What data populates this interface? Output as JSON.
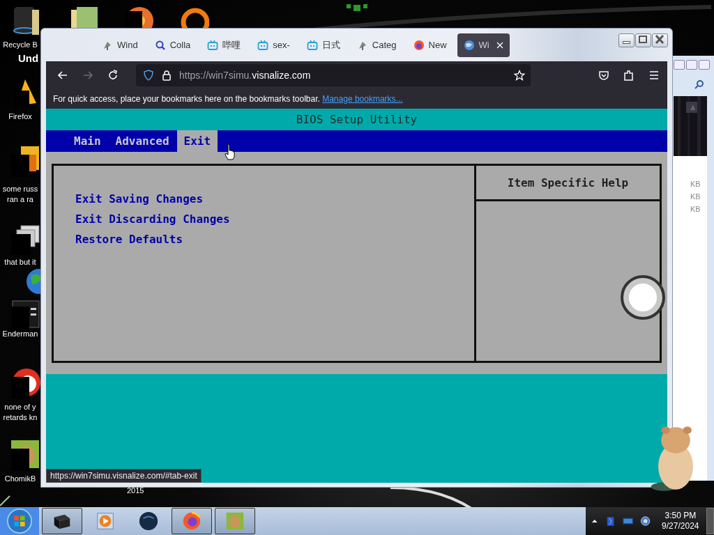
{
  "desktop_icons": [
    {
      "kind": "bin",
      "lines": [
        "Recycle B"
      ]
    },
    {
      "kind": "flame",
      "lines": [
        "Firefox"
      ]
    },
    {
      "kind": "document",
      "lines": [
        "some russ",
        "ran a ra"
      ]
    },
    {
      "kind": "stack",
      "lines": [
        "that but it"
      ]
    },
    {
      "kind": "globe"
    },
    {
      "kind": "terminal",
      "lines": [
        "Enderman"
      ]
    },
    {
      "kind": "redball",
      "lines": [
        "none of y",
        "retards kn"
      ]
    },
    {
      "kind": "hamster",
      "lines": [
        "ChomikB"
      ]
    },
    {
      "kind": "folder"
    },
    {
      "kind": "disc"
    },
    {
      "kind": "ring"
    }
  ],
  "desktop_labels": [
    {
      "text": "Und"
    },
    {
      "text": "2015"
    }
  ],
  "back_window": {
    "size_texts": [
      "KB",
      "KB",
      "KB"
    ]
  },
  "browser": {
    "tabs": [
      {
        "kind": "leaf",
        "label": "Wind",
        "selected": false
      },
      {
        "kind": "search",
        "label": "Colla",
        "selected": false
      },
      {
        "kind": "tv",
        "label": "哔哩",
        "selected": false
      },
      {
        "kind": "tv",
        "label": "sex-",
        "selected": false
      },
      {
        "kind": "tv",
        "label": "日式",
        "selected": false
      },
      {
        "kind": "leaf",
        "label": "Categ",
        "selected": false
      },
      {
        "kind": "fox",
        "label": "New",
        "selected": false
      },
      {
        "kind": "globe",
        "label": "Wi",
        "selected": true
      }
    ],
    "forward_disabled": true,
    "url": {
      "prefix": "https://win7simu.",
      "domain": "visnalize.com"
    },
    "bookmarks_bar": {
      "message": "For quick access, place your bookmarks here on the bookmarks toolbar.",
      "link": "Manage bookmarks..."
    },
    "status_url": "https://win7simu.visnalize.com/#tab-exit"
  },
  "bios": {
    "title": "BIOS Setup Utility",
    "menu": [
      {
        "label": "Main",
        "selected": false
      },
      {
        "label": "Advanced",
        "selected": false
      },
      {
        "label": "Exit",
        "selected": true
      }
    ],
    "items": [
      "Exit Saving Changes",
      "Exit Discarding Changes",
      "Restore Defaults"
    ],
    "help_title": "Item Specific Help"
  },
  "taskbar": {
    "items": [
      {
        "kind": "box",
        "running": true
      },
      {
        "kind": "media",
        "running": false
      },
      {
        "kind": "globe",
        "running": false
      },
      {
        "kind": "fox",
        "running": true
      },
      {
        "kind": "hamster",
        "running": true
      }
    ],
    "time": "3:50 PM",
    "date": "9/27/2024"
  }
}
